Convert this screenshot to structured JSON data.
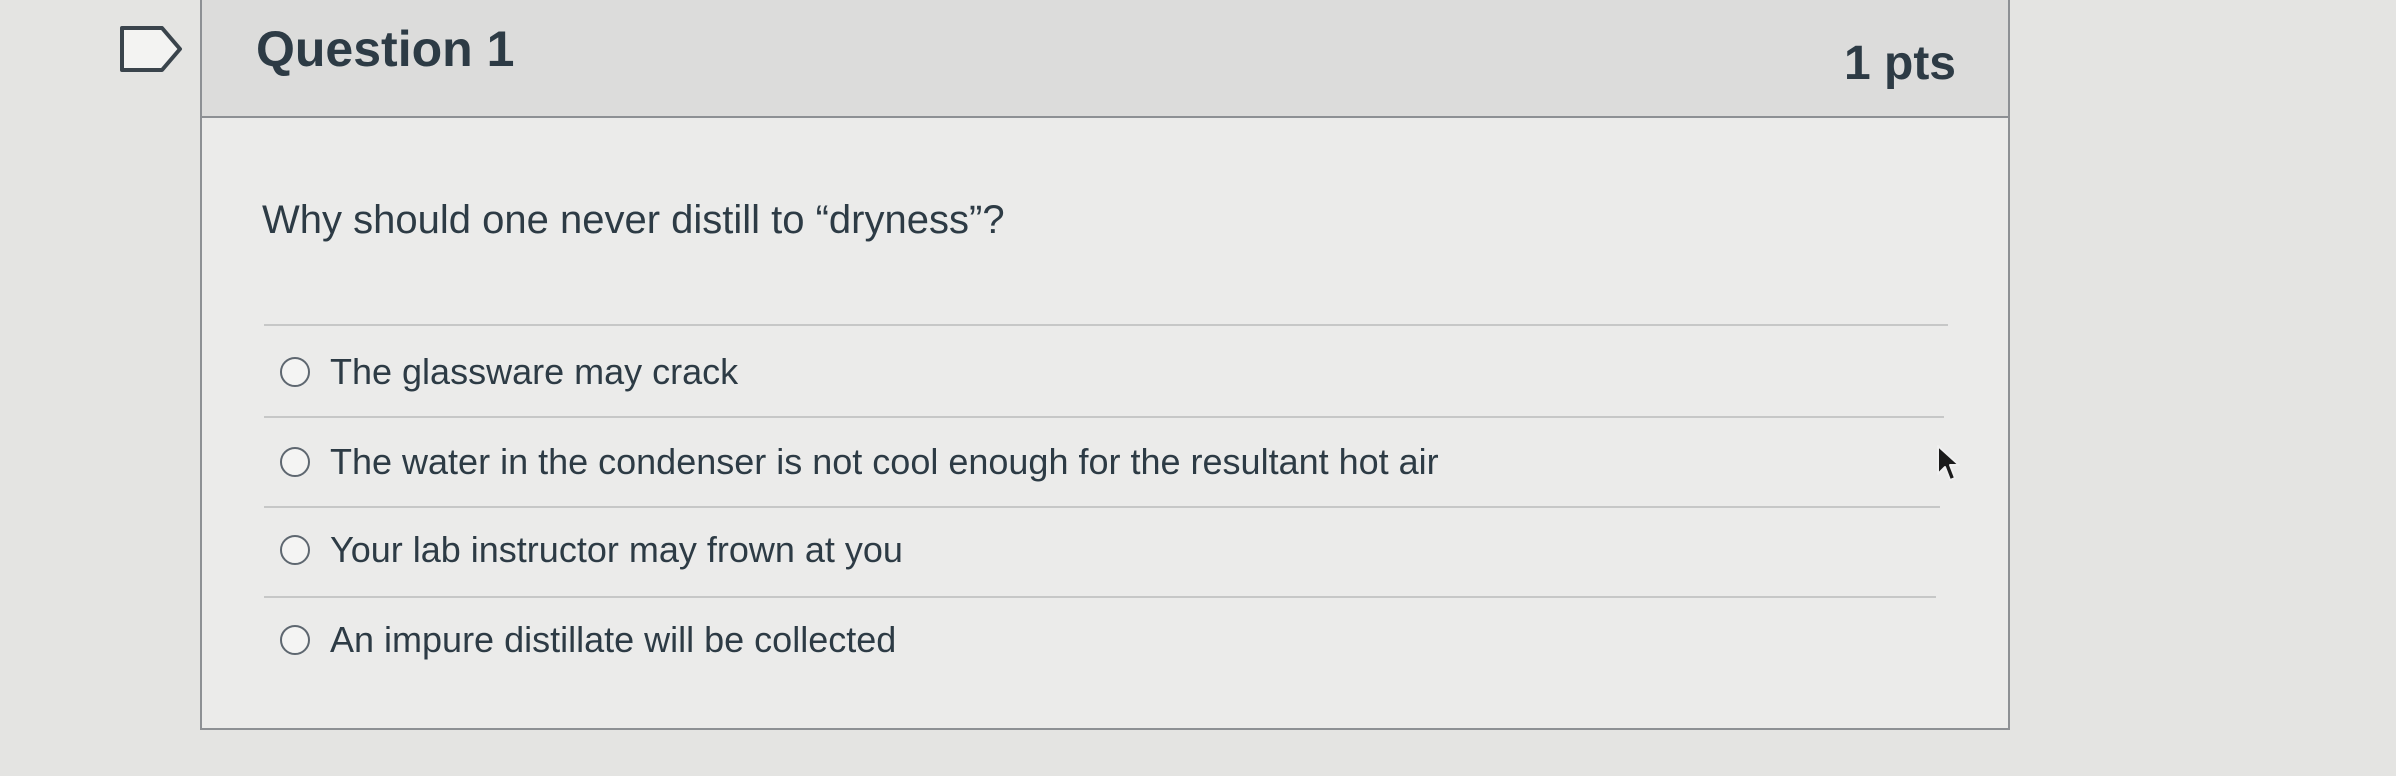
{
  "question": {
    "title": "Question 1",
    "points": "1 pts",
    "text": "Why should one never distill to “dryness”?",
    "answers": [
      {
        "label": "The glassware may crack",
        "selected": false
      },
      {
        "label": "The water in the condenser is not cool enough for the resultant hot air",
        "selected": false
      },
      {
        "label": "Your lab instructor may frown at you",
        "selected": false
      },
      {
        "label": "An impure distillate will be collected",
        "selected": false
      }
    ]
  },
  "icons": {
    "flag": "flag-icon",
    "cursor": "mouse-pointer-icon"
  },
  "colors": {
    "text": "#2d3b45",
    "header_background": "#dcdcdb",
    "card_background": "#ebebea",
    "border": "#8d9094"
  }
}
